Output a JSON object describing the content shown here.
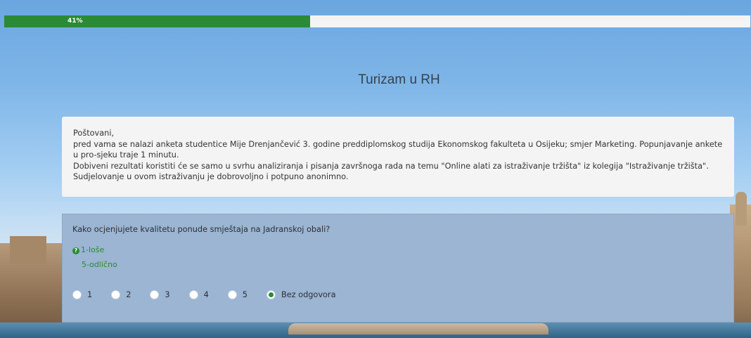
{
  "progress": {
    "value": 0.41,
    "label": "41%"
  },
  "survey": {
    "title": "Turizam u RH"
  },
  "intro": {
    "lines": [
      "Poštovani,",
      "pred vama se nalazi anketa studentice Mije Drenjančević 3. godine preddiplomskog studija Ekonomskog fakulteta u Osijeku; smjer Marketing. Popunjavanje ankete u pro-sjeku traje 1 minutu.",
      "Dobiveni rezultati koristiti će se samo u svrhu analiziranja i pisanja završnoga rada na temu \"Online alati za istraživanje tržišta\" iz kolegija \"Istraživanje tržišta\".",
      "Sudjelovanje u ovom istraživanju je dobrovoljno i potpuno anonimno."
    ]
  },
  "question": {
    "text": "Kako ocjenjujete kvalitetu ponude smještaja na Jadranskoj obali?",
    "hint_icon": "question-circle-icon",
    "hint_line1": "1-loše",
    "hint_line2": "5-odlično",
    "options": [
      {
        "label": "1",
        "checked": false
      },
      {
        "label": "2",
        "checked": false
      },
      {
        "label": "3",
        "checked": false
      },
      {
        "label": "4",
        "checked": false
      },
      {
        "label": "5",
        "checked": false
      },
      {
        "label": "Bez odgovora",
        "checked": true
      }
    ]
  },
  "colors": {
    "accent": "#2a8a35",
    "question_bg": "#9bb5d2",
    "panel_bg": "#f4f4f4"
  }
}
